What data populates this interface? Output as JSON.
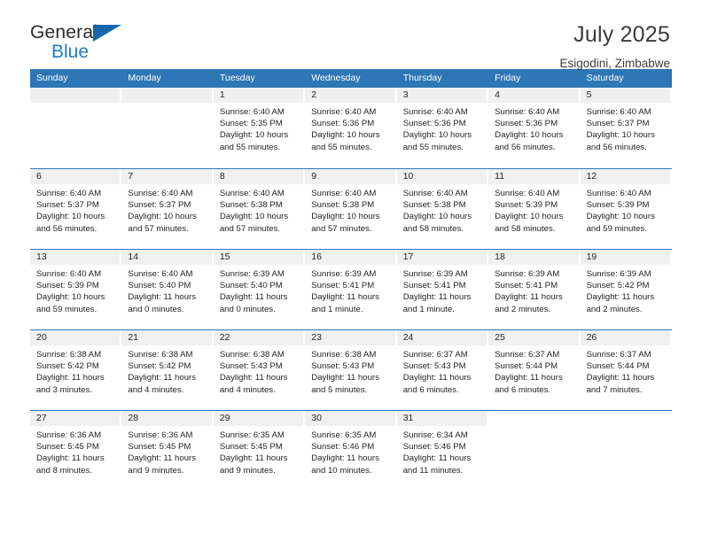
{
  "brand": {
    "name_top": "General",
    "name_bottom": "Blue",
    "accent_color": "#1f7bc1",
    "triangle_color": "#1667ad"
  },
  "header": {
    "title": "July 2025",
    "subtitle": "Esigodini, Zimbabwe"
  },
  "calendar": {
    "header_bg": "#2e76b6",
    "daynum_band_bg": "#f0f0f0",
    "weekdays": [
      "Sunday",
      "Monday",
      "Tuesday",
      "Wednesday",
      "Thursday",
      "Friday",
      "Saturday"
    ],
    "weeks": [
      [
        {
          "day": "",
          "empty": true
        },
        {
          "day": "",
          "empty": true
        },
        {
          "day": "1",
          "sunrise": "Sunrise: 6:40 AM",
          "sunset": "Sunset: 5:35 PM",
          "daylight": "Daylight: 10 hours and 55 minutes."
        },
        {
          "day": "2",
          "sunrise": "Sunrise: 6:40 AM",
          "sunset": "Sunset: 5:36 PM",
          "daylight": "Daylight: 10 hours and 55 minutes."
        },
        {
          "day": "3",
          "sunrise": "Sunrise: 6:40 AM",
          "sunset": "Sunset: 5:36 PM",
          "daylight": "Daylight: 10 hours and 55 minutes."
        },
        {
          "day": "4",
          "sunrise": "Sunrise: 6:40 AM",
          "sunset": "Sunset: 5:36 PM",
          "daylight": "Daylight: 10 hours and 56 minutes."
        },
        {
          "day": "5",
          "sunrise": "Sunrise: 6:40 AM",
          "sunset": "Sunset: 5:37 PM",
          "daylight": "Daylight: 10 hours and 56 minutes."
        }
      ],
      [
        {
          "day": "6",
          "sunrise": "Sunrise: 6:40 AM",
          "sunset": "Sunset: 5:37 PM",
          "daylight": "Daylight: 10 hours and 56 minutes."
        },
        {
          "day": "7",
          "sunrise": "Sunrise: 6:40 AM",
          "sunset": "Sunset: 5:37 PM",
          "daylight": "Daylight: 10 hours and 57 minutes."
        },
        {
          "day": "8",
          "sunrise": "Sunrise: 6:40 AM",
          "sunset": "Sunset: 5:38 PM",
          "daylight": "Daylight: 10 hours and 57 minutes."
        },
        {
          "day": "9",
          "sunrise": "Sunrise: 6:40 AM",
          "sunset": "Sunset: 5:38 PM",
          "daylight": "Daylight: 10 hours and 57 minutes."
        },
        {
          "day": "10",
          "sunrise": "Sunrise: 6:40 AM",
          "sunset": "Sunset: 5:38 PM",
          "daylight": "Daylight: 10 hours and 58 minutes."
        },
        {
          "day": "11",
          "sunrise": "Sunrise: 6:40 AM",
          "sunset": "Sunset: 5:39 PM",
          "daylight": "Daylight: 10 hours and 58 minutes."
        },
        {
          "day": "12",
          "sunrise": "Sunrise: 6:40 AM",
          "sunset": "Sunset: 5:39 PM",
          "daylight": "Daylight: 10 hours and 59 minutes."
        }
      ],
      [
        {
          "day": "13",
          "sunrise": "Sunrise: 6:40 AM",
          "sunset": "Sunset: 5:39 PM",
          "daylight": "Daylight: 10 hours and 59 minutes."
        },
        {
          "day": "14",
          "sunrise": "Sunrise: 6:40 AM",
          "sunset": "Sunset: 5:40 PM",
          "daylight": "Daylight: 11 hours and 0 minutes."
        },
        {
          "day": "15",
          "sunrise": "Sunrise: 6:39 AM",
          "sunset": "Sunset: 5:40 PM",
          "daylight": "Daylight: 11 hours and 0 minutes."
        },
        {
          "day": "16",
          "sunrise": "Sunrise: 6:39 AM",
          "sunset": "Sunset: 5:41 PM",
          "daylight": "Daylight: 11 hours and 1 minute."
        },
        {
          "day": "17",
          "sunrise": "Sunrise: 6:39 AM",
          "sunset": "Sunset: 5:41 PM",
          "daylight": "Daylight: 11 hours and 1 minute."
        },
        {
          "day": "18",
          "sunrise": "Sunrise: 6:39 AM",
          "sunset": "Sunset: 5:41 PM",
          "daylight": "Daylight: 11 hours and 2 minutes."
        },
        {
          "day": "19",
          "sunrise": "Sunrise: 6:39 AM",
          "sunset": "Sunset: 5:42 PM",
          "daylight": "Daylight: 11 hours and 2 minutes."
        }
      ],
      [
        {
          "day": "20",
          "sunrise": "Sunrise: 6:38 AM",
          "sunset": "Sunset: 5:42 PM",
          "daylight": "Daylight: 11 hours and 3 minutes."
        },
        {
          "day": "21",
          "sunrise": "Sunrise: 6:38 AM",
          "sunset": "Sunset: 5:42 PM",
          "daylight": "Daylight: 11 hours and 4 minutes."
        },
        {
          "day": "22",
          "sunrise": "Sunrise: 6:38 AM",
          "sunset": "Sunset: 5:43 PM",
          "daylight": "Daylight: 11 hours and 4 minutes."
        },
        {
          "day": "23",
          "sunrise": "Sunrise: 6:38 AM",
          "sunset": "Sunset: 5:43 PM",
          "daylight": "Daylight: 11 hours and 5 minutes."
        },
        {
          "day": "24",
          "sunrise": "Sunrise: 6:37 AM",
          "sunset": "Sunset: 5:43 PM",
          "daylight": "Daylight: 11 hours and 6 minutes."
        },
        {
          "day": "25",
          "sunrise": "Sunrise: 6:37 AM",
          "sunset": "Sunset: 5:44 PM",
          "daylight": "Daylight: 11 hours and 6 minutes."
        },
        {
          "day": "26",
          "sunrise": "Sunrise: 6:37 AM",
          "sunset": "Sunset: 5:44 PM",
          "daylight": "Daylight: 11 hours and 7 minutes."
        }
      ],
      [
        {
          "day": "27",
          "sunrise": "Sunrise: 6:36 AM",
          "sunset": "Sunset: 5:45 PM",
          "daylight": "Daylight: 11 hours and 8 minutes."
        },
        {
          "day": "28",
          "sunrise": "Sunrise: 6:36 AM",
          "sunset": "Sunset: 5:45 PM",
          "daylight": "Daylight: 11 hours and 9 minutes."
        },
        {
          "day": "29",
          "sunrise": "Sunrise: 6:35 AM",
          "sunset": "Sunset: 5:45 PM",
          "daylight": "Daylight: 11 hours and 9 minutes."
        },
        {
          "day": "30",
          "sunrise": "Sunrise: 6:35 AM",
          "sunset": "Sunset: 5:46 PM",
          "daylight": "Daylight: 11 hours and 10 minutes."
        },
        {
          "day": "31",
          "sunrise": "Sunrise: 6:34 AM",
          "sunset": "Sunset: 5:46 PM",
          "daylight": "Daylight: 11 hours and 11 minutes."
        },
        {
          "day": "",
          "empty": true,
          "blank": true
        },
        {
          "day": "",
          "empty": true,
          "blank": true
        }
      ]
    ]
  }
}
